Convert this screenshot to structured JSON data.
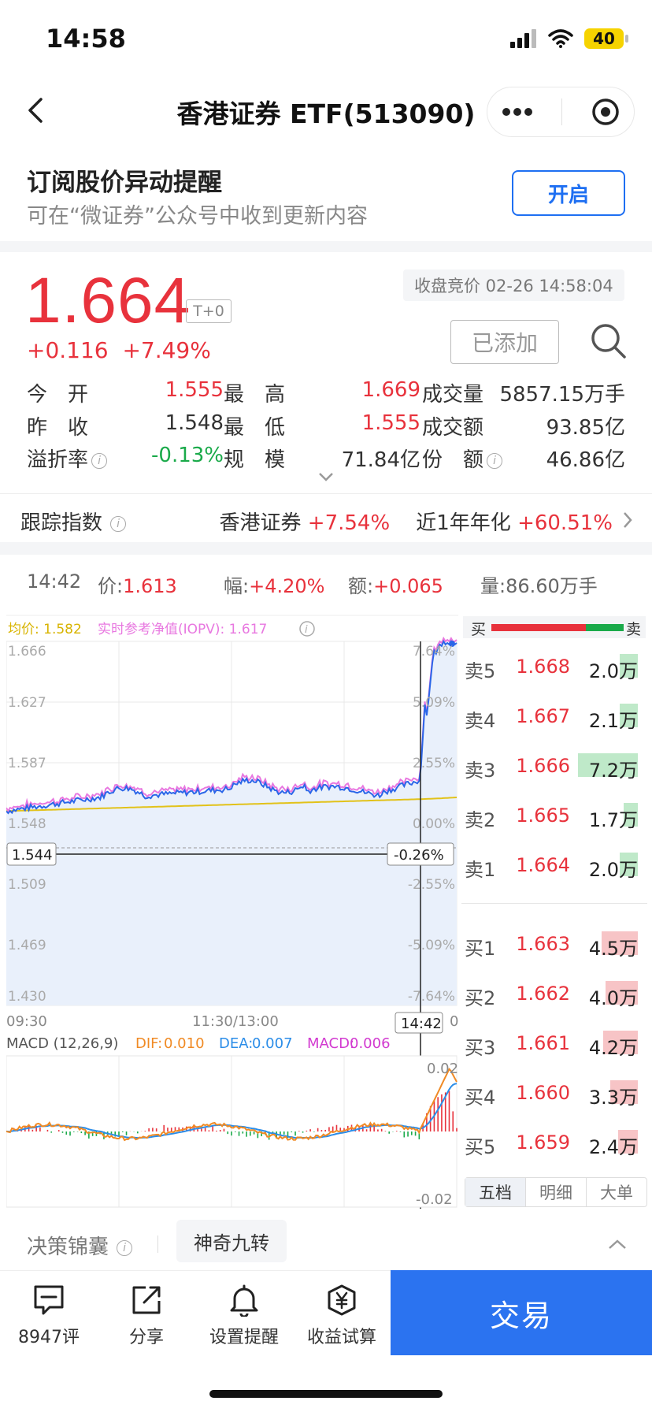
{
  "status_bar": {
    "time": "14:58",
    "battery": "40"
  },
  "nav": {
    "title": "香港证券 ETF(513090)"
  },
  "subscribe": {
    "title": "订阅股价异动提醒",
    "desc": "可在“微证券”公众号中收到更新内容",
    "button": "开启"
  },
  "quote": {
    "price": "1.664",
    "badge": "T+0",
    "change": "+0.116",
    "change_pct": "+7.49%",
    "auction": "收盘竞价 02-26 14:58:04",
    "added_label": "已添加"
  },
  "stats": {
    "open_label": "今　开",
    "open": "1.555",
    "high_label": "最　高",
    "high": "1.669",
    "volume_label": "成交量",
    "volume": "5857.15万手",
    "prev_close_label": "昨　收",
    "prev_close": "1.548",
    "low_label": "最　低",
    "low": "1.555",
    "amount_label": "成交额",
    "amount": "93.85亿",
    "premium_label": "溢折率",
    "premium": "-0.13%",
    "scale_label": "规　模",
    "scale": "71.84亿",
    "shares_label": "份　额",
    "shares": "46.86亿"
  },
  "tracking": {
    "label": "跟踪指数",
    "index_name": "香港证券",
    "index_change": "+7.54%",
    "annual_label": "近1年年化",
    "annual_value": "+60.51%"
  },
  "crosshair_quote": {
    "time": "14:42",
    "price_label": "价:",
    "price": "1.613",
    "range_label": "幅:",
    "range": "+4.20%",
    "amount_label": "额:",
    "amount": "+0.065",
    "volume_label": "量:",
    "volume": "86.60万手"
  },
  "chart": {
    "avg_label": "均价: 1.582",
    "iopv_label": "实时参考净值(IOPV): 1.617",
    "price_ticks": [
      "1.666",
      "1.627",
      "1.587",
      "1.548",
      "1.509",
      "1.469",
      "1.430"
    ],
    "pct_ticks": [
      "7.64%",
      "5.09%",
      "2.55%",
      "0.00%",
      "-2.55%",
      "-5.09%",
      "-7.64%"
    ],
    "time_ticks": [
      "09:30",
      "11:30/13:00",
      "0"
    ],
    "cursor_price": "1.544",
    "cursor_pct": "-0.26%",
    "cursor_time": "14:42",
    "macd_params": "MACD (12,26,9)",
    "dif_label": "DIF:",
    "dif": "0.010",
    "dea_label": "DEA:",
    "dea": "0.007",
    "macd_label": "MACD:",
    "macd": "0.006",
    "macd_top": "0.02",
    "macd_bottom": "-0.02",
    "colors": {
      "price": "#2b66e8",
      "iopv": "#e878e0",
      "avg": "#e2c21a",
      "dif": "#f08a24",
      "dea": "#2b8de8",
      "up": "#e8323c",
      "down": "#1aaa4a"
    }
  },
  "order_book": {
    "header_buy": "买",
    "header_sell": "卖",
    "asks": [
      {
        "label": "卖5",
        "price": "1.668",
        "vol": "2.0万",
        "fill": 0.1
      },
      {
        "label": "卖4",
        "price": "1.667",
        "vol": "2.1万",
        "fill": 0.1
      },
      {
        "label": "卖3",
        "price": "1.666",
        "vol": "7.2万",
        "fill": 0.33
      },
      {
        "label": "卖2",
        "price": "1.665",
        "vol": "1.7万",
        "fill": 0.08
      },
      {
        "label": "卖1",
        "price": "1.664",
        "vol": "2.0万",
        "fill": 0.1
      }
    ],
    "bids": [
      {
        "label": "买1",
        "price": "1.663",
        "vol": "4.5万",
        "fill": 0.2
      },
      {
        "label": "买2",
        "price": "1.662",
        "vol": "4.0万",
        "fill": 0.18
      },
      {
        "label": "买3",
        "price": "1.661",
        "vol": "4.2万",
        "fill": 0.19
      },
      {
        "label": "买4",
        "price": "1.660",
        "vol": "3.3万",
        "fill": 0.15
      },
      {
        "label": "买5",
        "price": "1.659",
        "vol": "2.4万",
        "fill": 0.11
      }
    ],
    "tabs": [
      "五档",
      "明细",
      "大单"
    ]
  },
  "decision": {
    "label": "决策锦囊",
    "chip": "神奇九转"
  },
  "bottom_bar": {
    "comments": "8947评",
    "share": "分享",
    "alert": "设置提醒",
    "calc": "收益试算",
    "trade": "交易"
  }
}
